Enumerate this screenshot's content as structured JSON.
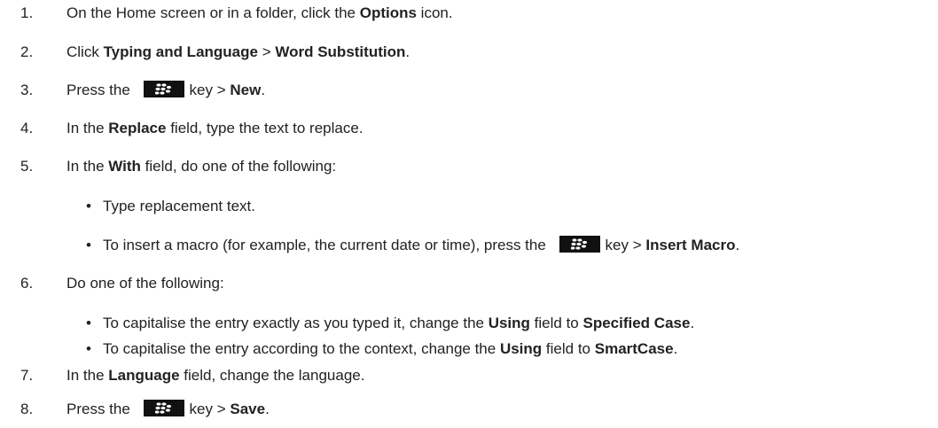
{
  "steps": [
    {
      "num": "1.",
      "parts": [
        "On the Home screen or in a folder, click the ",
        "Options",
        " icon."
      ]
    },
    {
      "num": "2.",
      "parts": [
        "Click ",
        "Typing and Language",
        " > ",
        "Word Substitution",
        "."
      ]
    },
    {
      "num": "3.",
      "parts": [
        "Press the ",
        "key > ",
        "New",
        "."
      ]
    },
    {
      "num": "4.",
      "parts": [
        "In the ",
        "Replace",
        " field, type the text to replace."
      ]
    },
    {
      "num": "5.",
      "parts": [
        "In the ",
        "With",
        " field, do one of the following:"
      ]
    },
    {
      "num": "6.",
      "parts": [
        "Do one of the following:"
      ]
    },
    {
      "num": "7.",
      "parts": [
        "In the ",
        "Language",
        " field, change the language."
      ]
    },
    {
      "num": "8.",
      "parts": [
        "Press the ",
        "key > ",
        "Save",
        "."
      ]
    }
  ],
  "step5_bullets": [
    {
      "parts": [
        "Type replacement text."
      ]
    },
    {
      "parts": [
        "To insert a macro (for example, the current date or time), press the ",
        "key > ",
        "Insert Macro",
        "."
      ]
    }
  ],
  "step6_bullets": [
    {
      "parts": [
        "To capitalise the entry exactly as you typed it, change the ",
        "Using",
        " field to ",
        "Specified Case",
        "."
      ]
    },
    {
      "parts": [
        "To capitalise the entry according to the context, change the ",
        "Using",
        " field to ",
        "SmartCase",
        "."
      ]
    }
  ],
  "bullet_char": "•",
  "icons": {
    "menu_key": "blackberry-menu-key-icon"
  },
  "colors": {
    "text": "#222222",
    "key_bg": "#111111"
  }
}
